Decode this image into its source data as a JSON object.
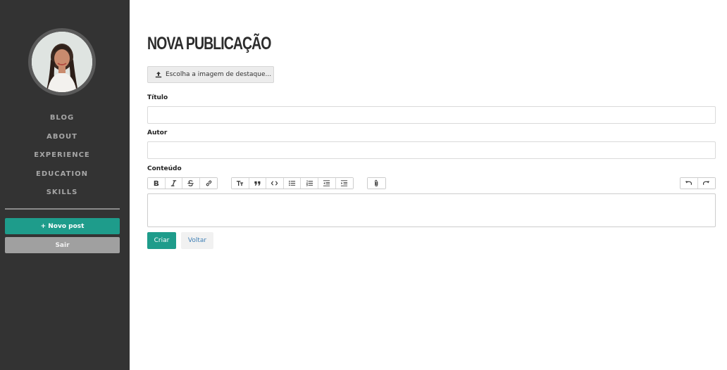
{
  "sidebar": {
    "nav": [
      {
        "label": "BLOG"
      },
      {
        "label": "ABOUT"
      },
      {
        "label": "EXPERIENCE"
      },
      {
        "label": "EDUCATION"
      },
      {
        "label": "SKILLS"
      }
    ],
    "new_post_label": "+ Novo post",
    "logout_label": "Sair"
  },
  "main": {
    "title": "NOVA PUBLICAÇÃO",
    "upload_label": "Escolha a imagem de destaque...",
    "fields": {
      "title_label": "Título",
      "title_value": "",
      "author_label": "Autor",
      "author_value": "",
      "content_label": "Conteúdo"
    },
    "create_label": "Criar",
    "back_label": "Voltar"
  },
  "toolbar": {
    "text_tools": [
      "bold-icon",
      "italic-icon",
      "strikethrough-icon",
      "link-icon"
    ],
    "block_tools": [
      "heading-icon",
      "quote-icon",
      "code-icon",
      "bullet-list-icon",
      "numbered-list-icon",
      "decrease-indent-icon",
      "increase-indent-icon"
    ],
    "file_tools": [
      "attach-icon"
    ],
    "history_tools": [
      "undo-icon",
      "redo-icon"
    ]
  },
  "colors": {
    "sidebar_bg": "#333333",
    "accent": "#1e9c8b",
    "secondary_button": "#a0a0a0",
    "link": "#3f7fb5"
  }
}
